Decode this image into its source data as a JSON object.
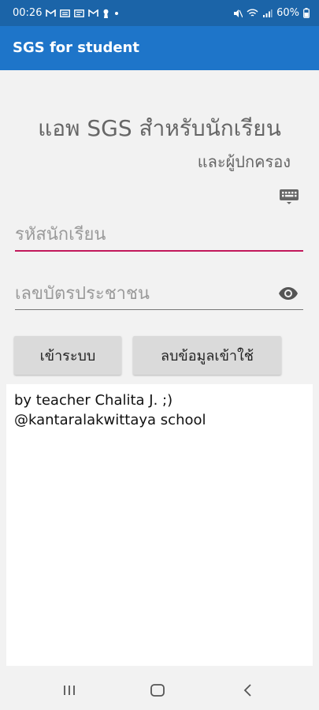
{
  "status_bar": {
    "time": "00:26",
    "battery": "60%",
    "icons": [
      "gmail-icon",
      "message-icon",
      "message-icon",
      "gmail-icon",
      "keyhole-icon",
      "dot-icon"
    ],
    "right_icons": [
      "mute-icon",
      "wifi-icon",
      "signal-icon",
      "battery-icon"
    ]
  },
  "app_bar": {
    "title": "SGS for student"
  },
  "main": {
    "headline": "แอพ SGS สำหรับนักเรียน",
    "subline": "และผู้ปกครอง",
    "student_id_placeholder": "รหัสนักเรียน",
    "citizen_id_placeholder": "เลขบัตรประชาชน",
    "login_button": "เข้าระบบ",
    "clear_button": "ลบข้อมูลเข้าใช้"
  },
  "info": {
    "line1": "by teacher Chalita J. ;)",
    "line2": "@kantaralakwittaya school"
  },
  "colors": {
    "status_bar": "#1b64a8",
    "app_bar": "#1e75c9",
    "active_field_underline": "#c2185b"
  }
}
